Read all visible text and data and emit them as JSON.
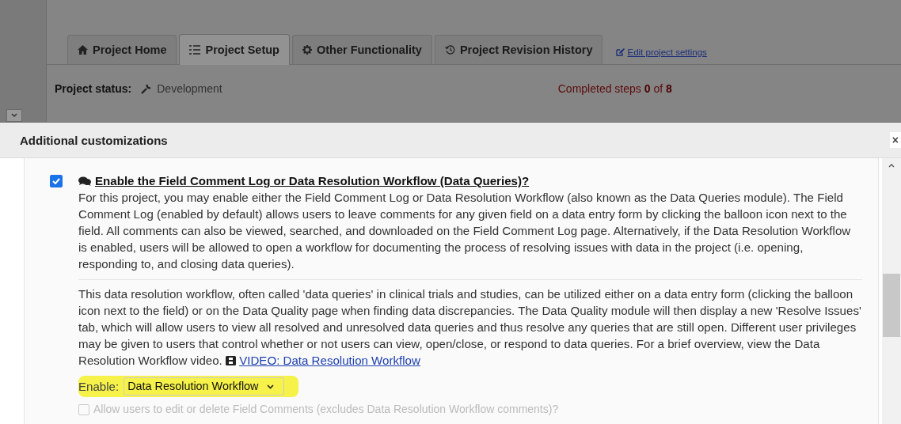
{
  "tabs": [
    {
      "label": "Project Home",
      "selected": false
    },
    {
      "label": "Project Setup",
      "selected": true
    },
    {
      "label": "Other Functionality",
      "selected": false
    },
    {
      "label": "Project Revision History",
      "selected": false
    }
  ],
  "edit_link": "Edit project settings",
  "status": {
    "label": "Project status:",
    "value": "Development"
  },
  "completed_steps": "Completed steps **0** of **8**",
  "dialog": {
    "title": "Additional customizations",
    "close": "×",
    "option": {
      "checked": true,
      "title": "Enable the Field Comment Log or Data Resolution Workflow (Data Queries)?",
      "paragraphs": [
        "For this project, you may enable either the Field Comment Log or Data Resolution Workflow (also known as the Data Queries module). The Field Comment Log (enabled by default) allows users to leave comments for any given field on a data entry form by clicking the balloon icon next to the field. All comments can also be viewed, searched, and downloaded on the Field Comment Log page. Alternatively, if the Data Resolution Workflow is enabled, users will be allowed to open a workflow for documenting the process of resolving issues with data in the project (i.e. opening, responding to, and closing data queries).",
        "This data resolution workflow, often called 'data queries' in clinical trials and studies, can be utilized either on a data entry form (clicking the balloon icon next to the field) or on the Data Quality page when finding data discrepancies. The Data Quality module will then display a new 'Resolve Issues' tab, which will allow users to view all resolved and unresolved data queries and thus resolve any queries that are still open. Different user privileges may be given to users that control whether or not users can view, open/close, or respond to data queries. For a brief overview, view the Data Resolution Workflow video."
      ],
      "video_link": "VIDEO: Data Resolution Workflow",
      "enable": {
        "label": "Enable:",
        "value": "Data Resolution Workflow",
        "highlighted": true
      },
      "sub_option": {
        "label": "Allow users to edit or delete Field Comments (excludes Data Resolution Workflow comments)?",
        "checked": false,
        "disabled": true
      }
    }
  }
}
